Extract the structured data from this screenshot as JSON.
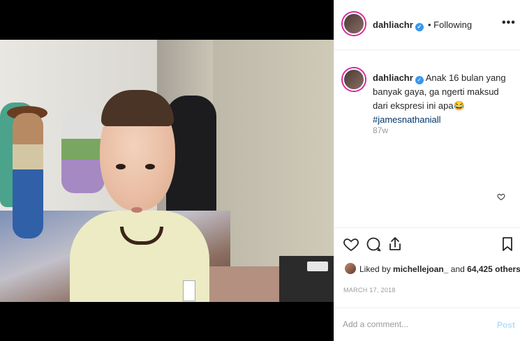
{
  "header": {
    "username": "dahliachr",
    "verified_icon": "verified-badge-icon",
    "follow_status": "• Following",
    "more": "•••"
  },
  "caption": {
    "username": "dahliachr",
    "text": "Anak 16 bulan yang banyak gaya, ga ngerti maksud dari ekspresi ini apa",
    "emoji": "😂",
    "hashtag": "#jamesnathaniall",
    "time_ago": "87w"
  },
  "actions": {
    "like_icon": "heart-icon",
    "comment_icon": "comment-icon",
    "share_icon": "share-icon",
    "save_icon": "bookmark-icon"
  },
  "likes": {
    "prefix": "Liked by",
    "liker": "michellejoan_",
    "joiner": "and",
    "count": "64,425 others"
  },
  "date": "MARCH 17, 2018",
  "comment": {
    "placeholder": "Add a comment...",
    "post_label": "Post"
  },
  "colors": {
    "accent": "#3897f0",
    "hashtag": "#003569",
    "muted": "#999999",
    "post_disabled": "#b2dffc"
  }
}
